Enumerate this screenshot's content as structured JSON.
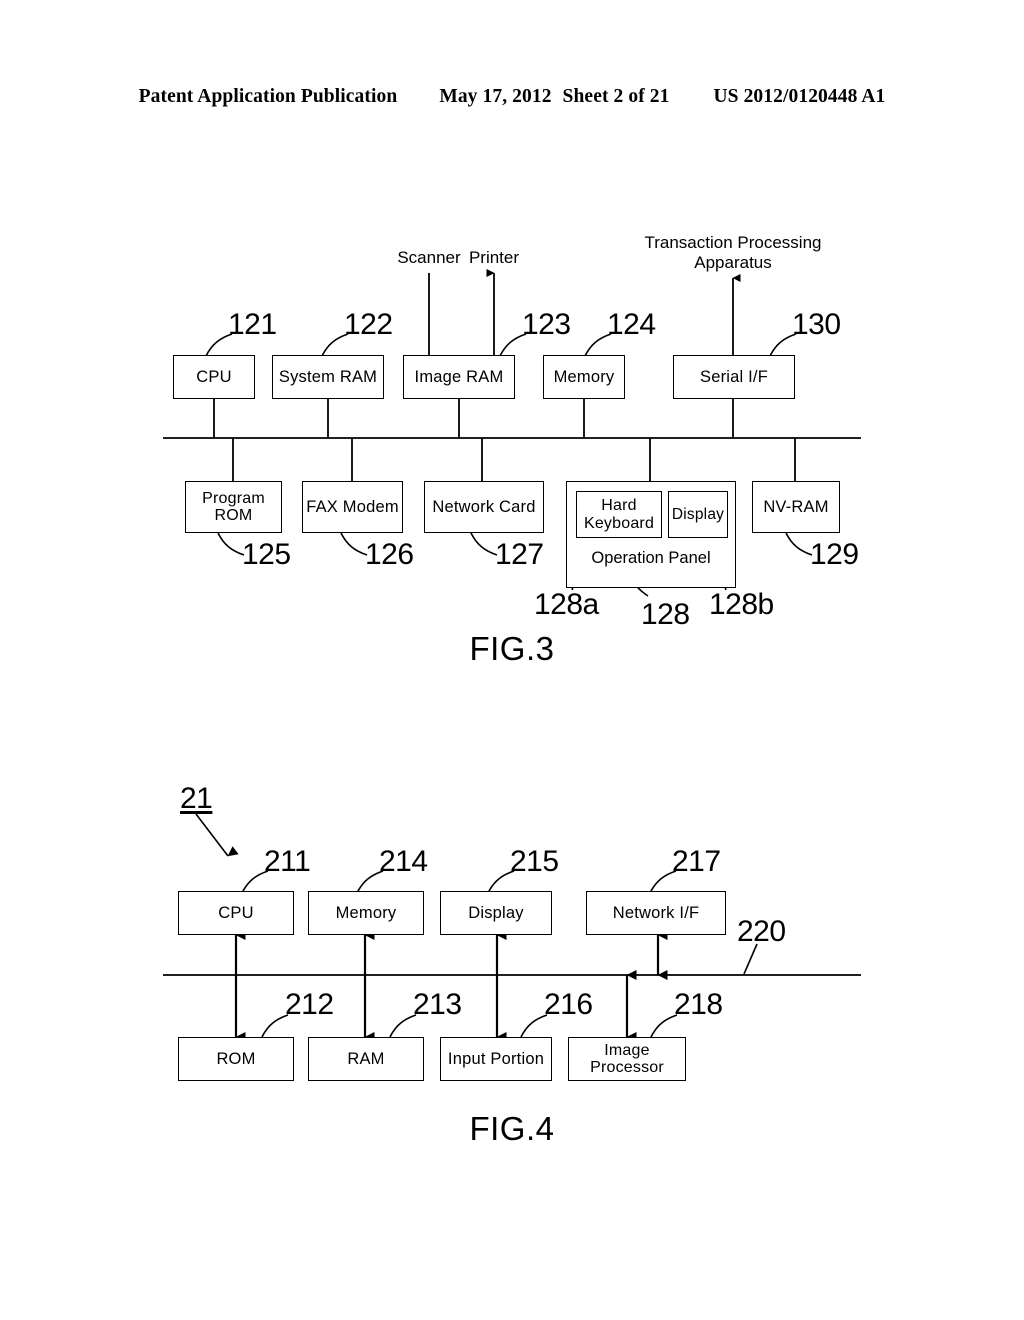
{
  "header": {
    "publication": "Patent Application Publication",
    "date": "May 17, 2012",
    "sheet": "Sheet 2 of 21",
    "number": "US 2012/0120448 A1"
  },
  "figure3": {
    "caption": "FIG.3",
    "external_labels": {
      "scanner": "Scanner",
      "printer": "Printer",
      "transaction_apparatus": "Transaction Processing\nApparatus",
      "transaction_apparatus_line1": "Transaction Processing",
      "transaction_apparatus_line2": "Apparatus"
    },
    "top_row": [
      {
        "label": "CPU",
        "ref": "121"
      },
      {
        "label": "System RAM",
        "ref": "122"
      },
      {
        "label": "Image RAM",
        "ref": "123"
      },
      {
        "label": "Memory",
        "ref": "124"
      },
      {
        "label": "Serial I/F",
        "ref": "130"
      }
    ],
    "bottom_row": [
      {
        "label_line1": "Program",
        "label_line2": "ROM",
        "ref": "125"
      },
      {
        "label_line1": "FAX Modem",
        "label_line2": "",
        "ref": "126"
      },
      {
        "label_line1": "Network Card",
        "label_line2": "",
        "ref": "127"
      },
      {
        "label_line1": "NV-RAM",
        "label_line2": "",
        "ref": "129"
      }
    ],
    "operation_panel": {
      "label": "Operation Panel",
      "ref": "128",
      "hard_keyboard": {
        "line1": "Hard",
        "line2": "Keyboard",
        "ref": "128a"
      },
      "display": {
        "label": "Display",
        "ref": "128b"
      }
    }
  },
  "figure4": {
    "caption": "FIG.4",
    "system_ref": "21",
    "bus_ref": "220",
    "top_row": [
      {
        "label": "CPU",
        "ref": "211"
      },
      {
        "label": "Memory",
        "ref": "214"
      },
      {
        "label": "Display",
        "ref": "215"
      },
      {
        "label": "Network I/F",
        "ref": "217"
      }
    ],
    "bottom_row": [
      {
        "label_line1": "ROM",
        "label_line2": "",
        "ref": "212"
      },
      {
        "label_line1": "RAM",
        "label_line2": "",
        "ref": "213"
      },
      {
        "label_line1": "Input Portion",
        "label_line2": "",
        "ref": "216"
      },
      {
        "label_line1": "Image",
        "label_line2": "Processor",
        "ref": "218"
      }
    ]
  },
  "colors": {
    "ink": "#000000",
    "paper": "#ffffff"
  }
}
